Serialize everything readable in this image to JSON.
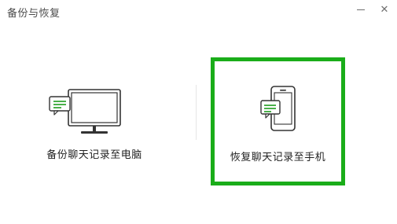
{
  "window": {
    "title": "备份与恢复",
    "minimize_icon": "minimize-icon",
    "close_icon": "close-icon",
    "close_glyph": "✕"
  },
  "options": {
    "backup_to_pc": {
      "label": "备份聊天记录至电脑",
      "icon": "monitor-chat-icon"
    },
    "restore_to_phone": {
      "label": "恢复聊天记录至手机",
      "icon": "phone-chat-icon",
      "selected": true
    }
  },
  "colors": {
    "accent_green": "#1aad19",
    "icon_green": "#4ab04a",
    "icon_stroke": "#333333"
  }
}
